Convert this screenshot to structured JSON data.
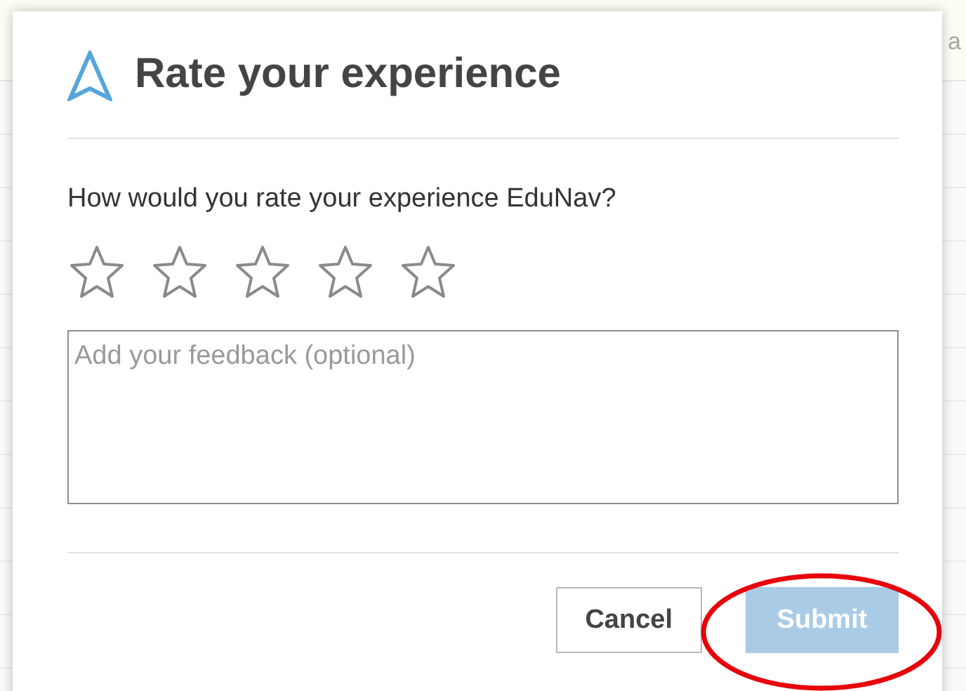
{
  "background": {
    "text": "a"
  },
  "dialog": {
    "title": "Rate your experience",
    "question": "How would you rate your experience EduNav?",
    "rating": {
      "stars": 0
    },
    "feedback": {
      "placeholder": "Add your feedback (optional)"
    },
    "buttons": [
      {
        "label": "Cancel",
        "kind": "secondary",
        "disabled": false
      },
      {
        "label": "Submit",
        "kind": "primary",
        "disabled": true
      }
    ]
  }
}
